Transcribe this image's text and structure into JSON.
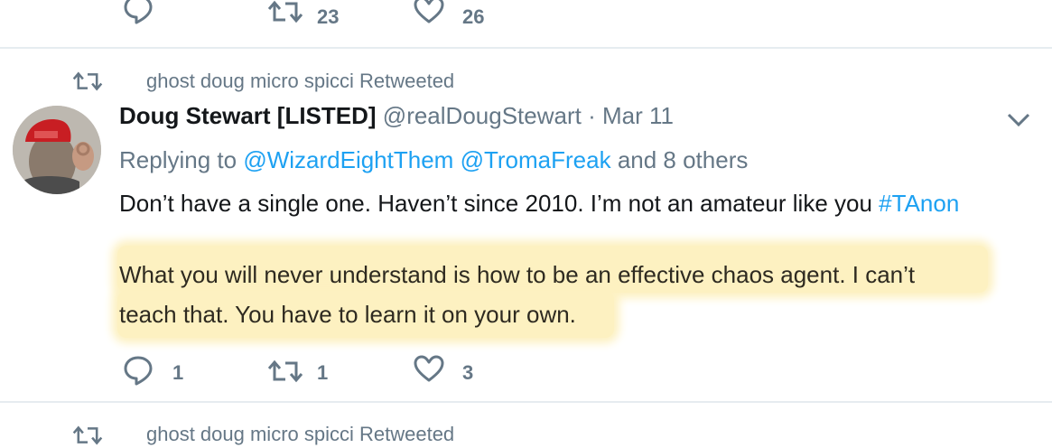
{
  "top_actions": {
    "retweet_count": "23",
    "like_count": "26"
  },
  "tweet": {
    "retweeted_by": "ghost doug micro spicci Retweeted",
    "author_name": "Doug Stewart [LISTED]",
    "author_handle": "@realDougStewart",
    "separator": "·",
    "date": "Mar 11",
    "replying_prefix": "Replying to",
    "replying_to_1": "@WizardEightThem",
    "replying_to_2": "@TromaFreak",
    "replying_suffix": "and 8 others",
    "text_line_1": "Don’t have a single one. Haven’t since 2010. I’m not an amateur like you",
    "hashtag": "#TAnon",
    "highlighted_line_1": "What you will never understand is how to be an effective chaos agent. I can’t",
    "highlighted_line_2": "teach that. You have to learn it on your own.",
    "reply_count": "1",
    "retweet_count": "1",
    "like_count": "3"
  },
  "next_tweet": {
    "retweeted_by": "ghost doug micro spicci Retweeted"
  },
  "colors": {
    "accent": "#1da1f2",
    "muted": "#657786",
    "highlight": "#fdf1c1",
    "divider": "#e6ecf0"
  },
  "icons": [
    "reply-icon",
    "retweet-icon",
    "like-icon",
    "chevron-down-icon"
  ]
}
